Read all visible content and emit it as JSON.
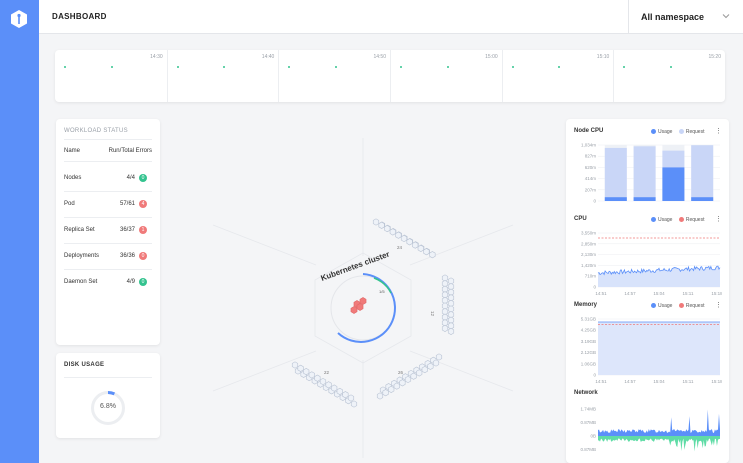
{
  "header": {
    "title": "DASHBOARD",
    "namespace": "All namespace"
  },
  "colors": {
    "sidebar": "#5b8ff9",
    "usage": "#5b8ff9",
    "request": "#f07a7a",
    "request_cpu": "#c9d6f7",
    "green": "#34c38f",
    "red": "#f07a7a",
    "hex": "#eef2f8"
  },
  "timeline": {
    "labels": [
      "14:30",
      "14:40",
      "14:50",
      "15:00",
      "15:10",
      "15:20"
    ]
  },
  "workload": {
    "title": "WORKLOAD STATUS",
    "col_name": "Name",
    "col_val": "Run/Total Errors",
    "rows": [
      {
        "name": "Nodes",
        "value": "4/4",
        "errors": "0",
        "status": "ok"
      },
      {
        "name": "Pod",
        "value": "57/61",
        "errors": "4",
        "status": "error"
      },
      {
        "name": "Replica Set",
        "value": "36/37",
        "errors": "1",
        "status": "error"
      },
      {
        "name": "Deployments",
        "value": "36/36",
        "errors": "0",
        "status": "error"
      },
      {
        "name": "Daemon Set",
        "value": "4/9",
        "errors": "0",
        "status": "ok"
      }
    ]
  },
  "disk": {
    "title": "DISK USAGE",
    "percent": 6.8,
    "label": "6.8%"
  },
  "cluster": {
    "title": "Kubernetes cluster",
    "ring_label": "1/5",
    "groups": [
      {
        "label": "24"
      },
      {
        "label": "12"
      },
      {
        "label": "26"
      },
      {
        "label": "22"
      }
    ]
  },
  "right": {
    "node_cpu": {
      "title": "Node CPU",
      "legend": [
        "Usage",
        "Request"
      ],
      "yticks": [
        "1,034m",
        "827m",
        "620m",
        "414m",
        "207m",
        "0"
      ],
      "chart_data": {
        "type": "bar",
        "series": [
          {
            "name": "Usage",
            "values": [
              70,
              70,
              620,
              70
            ]
          },
          {
            "name": "Request",
            "values": [
              980,
              1010,
              930,
              1030
            ]
          }
        ],
        "ylim": [
          0,
          1034
        ]
      }
    },
    "cpu": {
      "title": "CPU",
      "legend": [
        "Usage",
        "Request"
      ],
      "yticks": [
        "3,550m",
        "2,850m",
        "2,130m",
        "1,420m",
        "710m",
        "0"
      ],
      "xticks": [
        "14:51",
        "14:57",
        "15:04",
        "15:11",
        "15:18"
      ]
    },
    "memory": {
      "title": "Memory",
      "legend": [
        "Usage",
        "Request"
      ],
      "yticks": [
        "5.31GB",
        "4.25GB",
        "3.19GB",
        "2.12GB",
        "1.06GB",
        "0"
      ],
      "xticks": [
        "14:51",
        "14:57",
        "15:04",
        "15:11",
        "15:18"
      ]
    },
    "network": {
      "title": "Network",
      "yticks": [
        "1.74MB",
        "0.87MB",
        "0B",
        "0.87MB"
      ]
    }
  }
}
